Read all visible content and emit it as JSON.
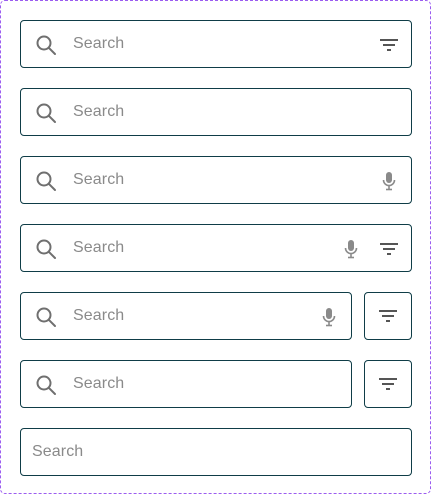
{
  "search_bars": [
    {
      "placeholder": "Search",
      "icons": [
        "search-icon",
        "filter-icon"
      ]
    },
    {
      "placeholder": "Search",
      "icons": [
        "search-icon"
      ]
    },
    {
      "placeholder": "Search",
      "icons": [
        "search-icon",
        "mic-icon"
      ]
    },
    {
      "placeholder": "Search",
      "icons": [
        "search-icon",
        "mic-icon",
        "filter-icon"
      ]
    },
    {
      "placeholder": "Search",
      "icons": [
        "search-icon",
        "mic-icon"
      ],
      "external_button": "filter-icon"
    },
    {
      "placeholder": "Search",
      "icons": [
        "search-icon"
      ],
      "external_button": "filter-icon"
    },
    {
      "placeholder": "Search",
      "icons": []
    }
  ],
  "colors": {
    "border": "#0f3d47",
    "placeholder": "#8a8a8a",
    "icon": "#6f6f6f",
    "frame_dashed": "#9b5cf0"
  }
}
